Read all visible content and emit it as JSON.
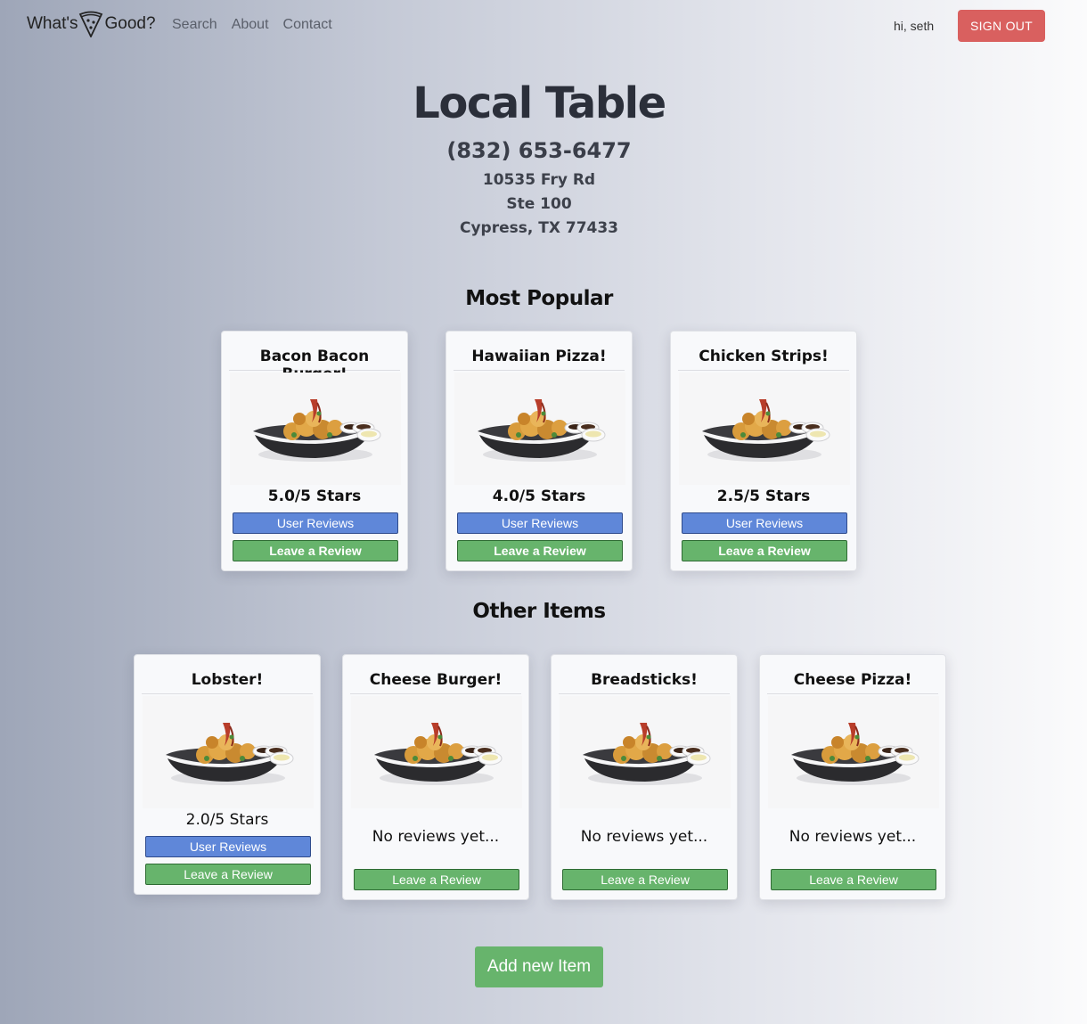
{
  "nav": {
    "brand_left": "What's",
    "brand_right": "Good?",
    "links": [
      "Search",
      "About",
      "Contact"
    ],
    "greeting": "hi, seth",
    "signout_label": "SIGN OUT"
  },
  "restaurant": {
    "name": "Local Table",
    "phone": "(832) 653-6477",
    "address_line1": "10535 Fry Rd",
    "address_line2": "Ste 100",
    "address_line3": "Cypress, TX 77433"
  },
  "sections": {
    "popular_title": "Most Popular",
    "other_title": "Other Items"
  },
  "popular_items": [
    {
      "name": "Bacon Bacon Burger!",
      "rating": "5.0/5 Stars",
      "user_reviews_label": "User Reviews",
      "leave_review_label": "Leave a Review"
    },
    {
      "name": "Hawaiian Pizza!",
      "rating": "4.0/5 Stars",
      "user_reviews_label": "User Reviews",
      "leave_review_label": "Leave a Review"
    },
    {
      "name": "Chicken Strips!",
      "rating": "2.5/5 Stars",
      "user_reviews_label": "User Reviews",
      "leave_review_label": "Leave a Review"
    }
  ],
  "other_items": [
    {
      "name": "Lobster!",
      "rating": "2.0/5 Stars",
      "user_reviews_label": "User Reviews",
      "leave_review_label": "Leave a Review"
    },
    {
      "name": "Cheese Burger!",
      "rating": "No reviews yet...",
      "leave_review_label": "Leave a Review"
    },
    {
      "name": "Breadsticks!",
      "rating": "No reviews yet...",
      "leave_review_label": "Leave a Review"
    },
    {
      "name": "Cheese Pizza!",
      "rating": "No reviews yet...",
      "leave_review_label": "Leave a Review"
    }
  ],
  "add_item_label": "Add new Item",
  "colors": {
    "signout": "#d9605f",
    "user_reviews_button": "#5f87d9",
    "leave_review_button": "#67b46c"
  },
  "icons": {
    "brand": "pizza-slice-icon",
    "food": "food-dish-photo"
  }
}
